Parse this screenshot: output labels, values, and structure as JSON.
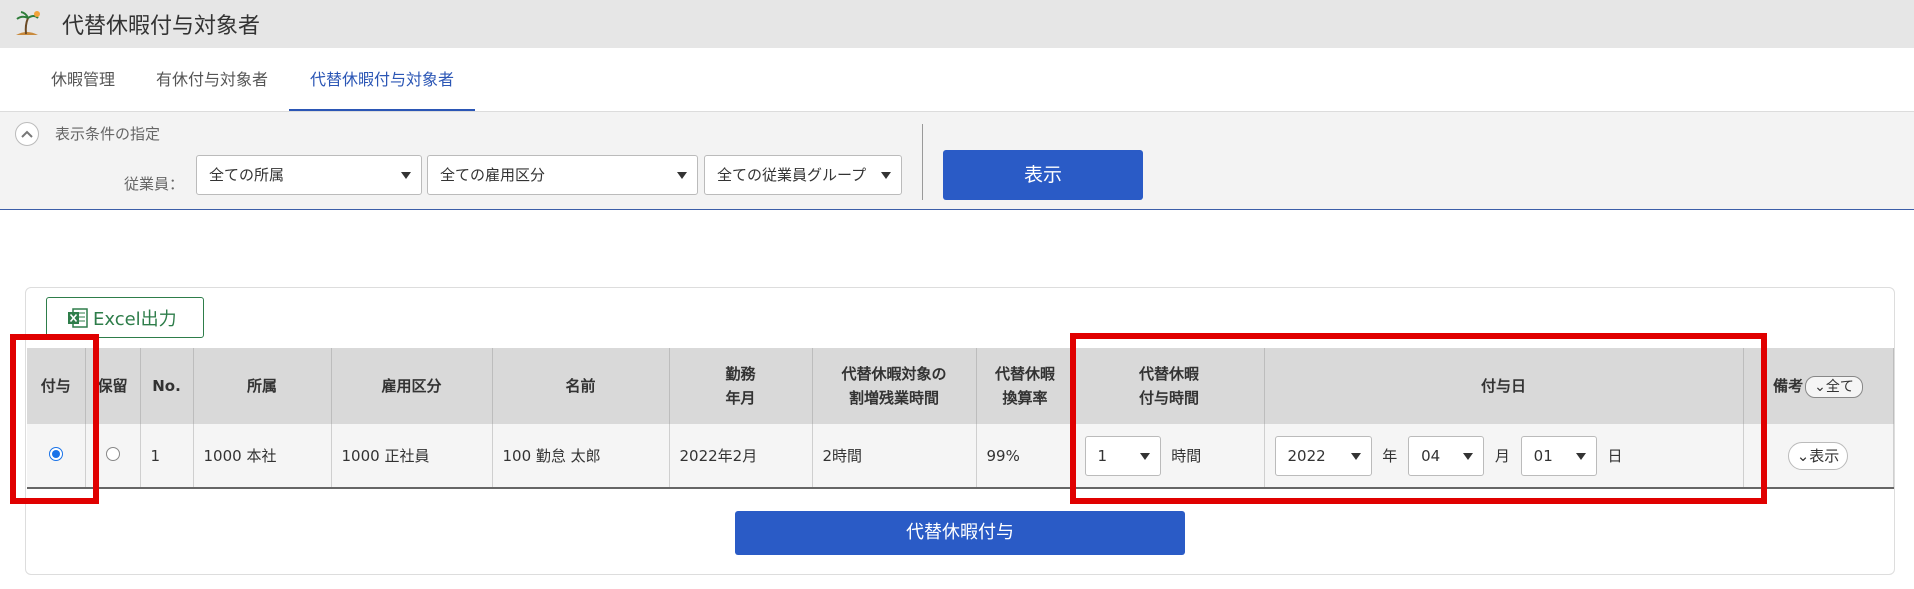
{
  "header": {
    "title": "代替休暇付与対象者",
    "logo_icon": "island-palm-icon"
  },
  "tabs": [
    {
      "label": "休暇管理",
      "active": false
    },
    {
      "label": "有休付与対象者",
      "active": false
    },
    {
      "label": "代替休暇付与対象者",
      "active": true
    }
  ],
  "filter": {
    "section_label": "表示条件の指定",
    "employee_label": "従業員：",
    "affiliation": "全ての所属",
    "employment_type": "全ての雇用区分",
    "employee_group": "全ての従業員グループ",
    "show_button": "表示"
  },
  "toolbar": {
    "excel_label": "Excel出力"
  },
  "table": {
    "headers": {
      "grant": "付与",
      "hold": "保留",
      "no": "No.",
      "affiliation": "所属",
      "employment_type": "雇用区分",
      "name": "名前",
      "work_month_1": "勤務",
      "work_month_2": "年月",
      "overtime_1": "代替休暇対象の",
      "overtime_2": "割増残業時間",
      "rate_1": "代替休暇",
      "rate_2": "換算率",
      "grant_hours_1": "代替休暇",
      "grant_hours_2": "付与時間",
      "grant_date": "付与日",
      "remarks": "備考",
      "all_button": "全て"
    },
    "rows": [
      {
        "grant_checked": true,
        "hold_checked": false,
        "no": "1",
        "affiliation": "1000 本社",
        "employment_type": "1000 正社員",
        "name": "100 勤怠 太郎",
        "work_month": "2022年2月",
        "overtime": "2時間",
        "rate": "99%",
        "grant_hours": "1",
        "hours_unit": "時間",
        "year": "2022",
        "year_unit": "年",
        "month": "04",
        "month_unit": "月",
        "day": "01",
        "day_unit": "日",
        "remarks_button": "表示"
      }
    ]
  },
  "grant_button": "代替休暇付与",
  "colors": {
    "accent": "#2a5bc6",
    "highlight": "#e00000",
    "excel_green": "#2e7d4a"
  }
}
